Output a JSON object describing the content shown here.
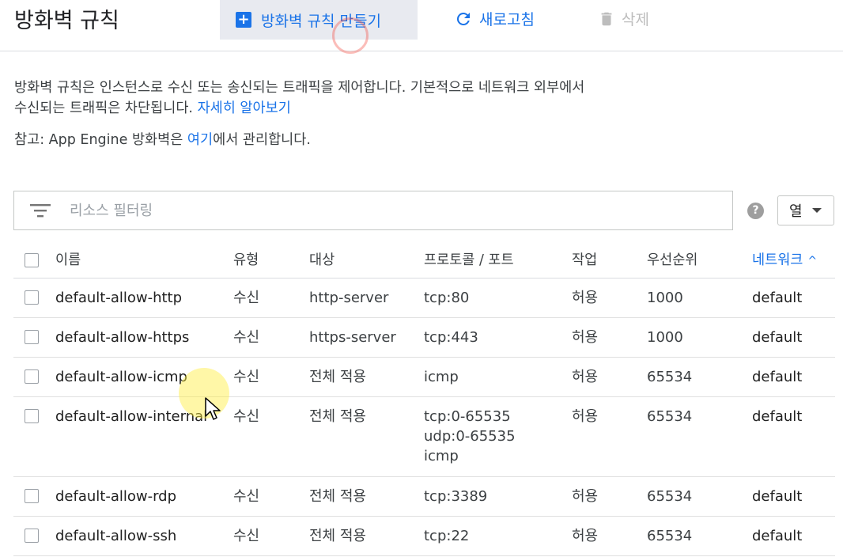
{
  "header": {
    "title": "방화벽 규칙",
    "create_label": "방화벽 규칙 만들기",
    "refresh_label": "새로고침",
    "delete_label": "삭제"
  },
  "description": {
    "text": "방화벽 규칙은 인스턴스로 수신 또는 송신되는 트래픽을 제어합니다. 기본적으로 네트워크 외부에서 수신되는 트래픽은 차단됩니다. ",
    "learn_more": "자세히 알아보기",
    "note_prefix": "참고: App Engine 방화벽은 ",
    "note_link": "여기",
    "note_suffix": "에서 관리합니다."
  },
  "filter": {
    "placeholder": "리소스 필터링",
    "columns_label": "열"
  },
  "table": {
    "headers": {
      "name": "이름",
      "type": "유형",
      "target": "대상",
      "protocol": "프로토콜 / 포트",
      "action": "작업",
      "priority": "우선순위",
      "network": "네트워크"
    },
    "rows": [
      {
        "name": "default-allow-http",
        "type": "수신",
        "target": "http-server",
        "protocol": [
          "tcp:80"
        ],
        "action": "허용",
        "priority": "1000",
        "network": "default"
      },
      {
        "name": "default-allow-https",
        "type": "수신",
        "target": "https-server",
        "protocol": [
          "tcp:443"
        ],
        "action": "허용",
        "priority": "1000",
        "network": "default"
      },
      {
        "name": "default-allow-icmp",
        "type": "수신",
        "target": "전체 적용",
        "protocol": [
          "icmp"
        ],
        "action": "허용",
        "priority": "65534",
        "network": "default"
      },
      {
        "name": "default-allow-internal",
        "type": "수신",
        "target": "전체 적용",
        "protocol": [
          "tcp:0-65535",
          "udp:0-65535",
          "icmp"
        ],
        "action": "허용",
        "priority": "65534",
        "network": "default"
      },
      {
        "name": "default-allow-rdp",
        "type": "수신",
        "target": "전체 적용",
        "protocol": [
          "tcp:3389"
        ],
        "action": "허용",
        "priority": "65534",
        "network": "default"
      },
      {
        "name": "default-allow-ssh",
        "type": "수신",
        "target": "전체 적용",
        "protocol": [
          "tcp:22"
        ],
        "action": "허용",
        "priority": "65534",
        "network": "default"
      }
    ]
  },
  "colors": {
    "accent": "#1a73e8",
    "create_button_bg": "#e8eaf0",
    "disabled": "#bdbdbd"
  }
}
